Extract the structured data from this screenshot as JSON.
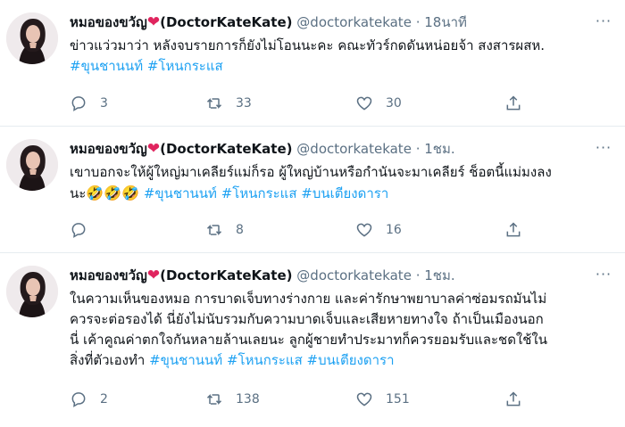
{
  "tweets": [
    {
      "name": "หมอของขวัญ",
      "display_suffix": "(DoctorKateKate)",
      "handle": "@doctorkatekate",
      "separator": "·",
      "time": "18นาที",
      "line1": "ข่าวแว่วมาว่า หลังจบรายการก็ยังไม่โอนนะคะ คณะทัวร์กดดันหน่อยจ้า สงสารผสห.",
      "tags": [
        "#ขุนชานนท์",
        "#โหนกระแส"
      ],
      "replies": "3",
      "retweets": "33",
      "likes": "30"
    },
    {
      "name": "หมอของขวัญ",
      "display_suffix": "(DoctorKateKate)",
      "handle": "@doctorkatekate",
      "separator": "·",
      "time": "1ชม.",
      "line1": "เขาบอกจะให้ผู้ใหญ่มาเคลียร์แม่ก็รอ ผู้ใหญ่บ้านหรือกำนันจะมาเคลียร์ ช็อตนี้แม่มงลง",
      "line2_prefix": "นะ",
      "emoji": "🤣🤣🤣",
      "tags": [
        "#ขุนชานนท์",
        "#โหนกระแส",
        "#บนเตียงดารา"
      ],
      "replies": "",
      "retweets": "8",
      "likes": "16"
    },
    {
      "name": "หมอของขวัญ",
      "display_suffix": "(DoctorKateKate)",
      "handle": "@doctorkatekate",
      "separator": "·",
      "time": "1ชม.",
      "line1": "ในความเห็นของหมอ การบาดเจ็บทางร่างกาย และค่ารักษาพยาบาลค่าซ่อมรถมันไม่",
      "line2": "ควรจะต่อรองได้ นี่ยังไม่นับรวมกับความบาดเจ็บและเสียหายทางใจ ถ้าเป็นเมืองนอก",
      "line3": "นี่ เค้าคูณค่าตกใจกันหลายล้านเลยนะ ลูกผู้ชายทำประมาทก็ควรยอมรับและชดใช้ใน",
      "line4_prefix": "สิ่งที่ตัวเองทำ",
      "tags": [
        "#ขุนชานนท์",
        "#โหนกระแส",
        "#บนเตียงดารา"
      ],
      "replies": "2",
      "retweets": "138",
      "likes": "151"
    }
  ],
  "colors": {
    "text": "#0f1419",
    "secondary": "#5b7083",
    "hashtag": "#1da1f2",
    "heart": "#e0245e",
    "divider": "#e6ecf0"
  },
  "icons": {
    "heart_emoji": "heart-emoji-icon",
    "reply": "reply-icon",
    "retweet": "retweet-icon",
    "like": "like-icon",
    "share": "share-icon"
  }
}
